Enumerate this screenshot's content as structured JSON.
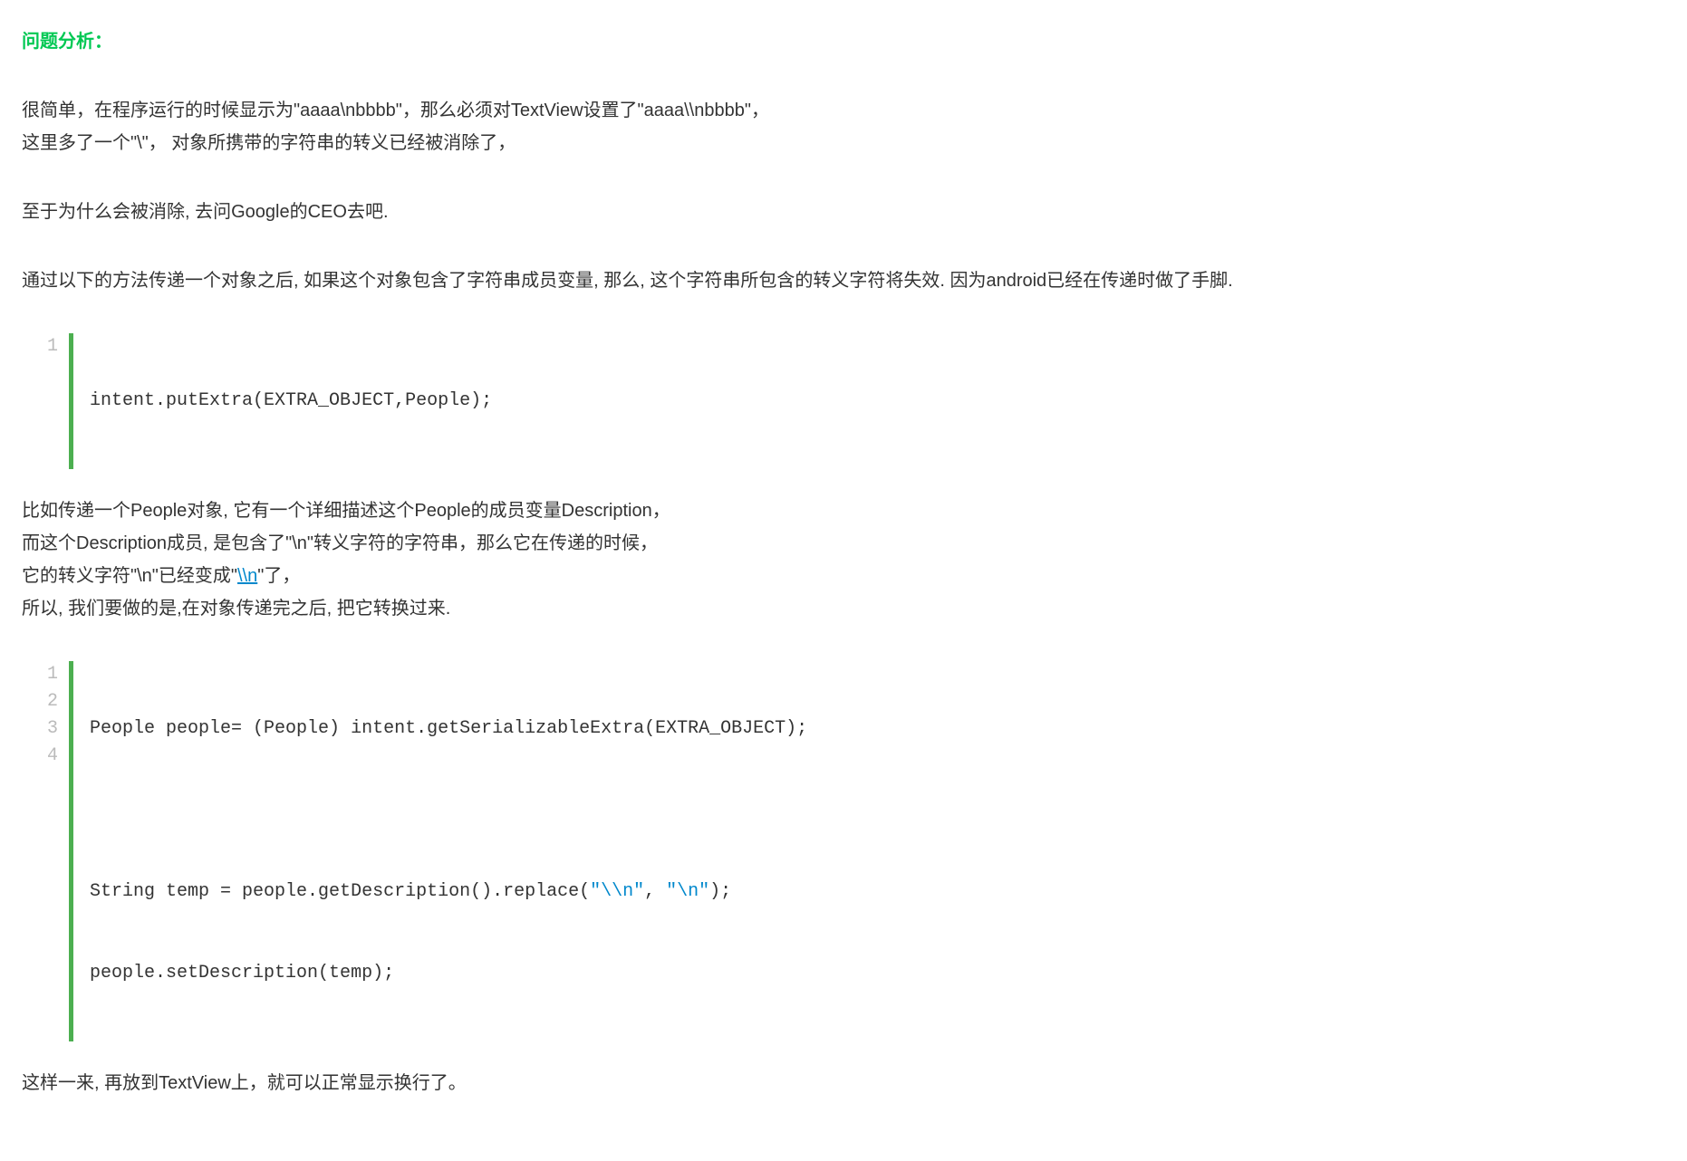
{
  "heading": "问题分析：",
  "para1": {
    "line1": "很简单，在程序运行的时候显示为\"aaaa\\nbbbb\"，那么必须对TextView设置了\"aaaa\\\\nbbbb\"，",
    "line2": "这里多了一个\"\\\"， 对象所携带的字符串的转义已经被消除了，"
  },
  "para2": "至于为什么会被消除, 去问Google的CEO去吧.",
  "para3": "通过以下的方法传递一个对象之后, 如果这个对象包含了字符串成员变量, 那么, 这个字符串所包含的转义字符将失效. 因为android已经在传递时做了手脚.",
  "code1": {
    "ln1": "1",
    "line1": "intent.putExtra(EXTRA_OBJECT,People);"
  },
  "para4": {
    "line1": "比如传递一个People对象, 它有一个详细描述这个People的成员变量Description，",
    "line2": "而这个Description成员, 是包含了\"\\n\"转义字符的字符串，那么它在传递的时候，",
    "line3_a": "它的转义字符\"\\n\"已经变成\"",
    "line3_link": "\\\\n",
    "line3_b": "\"了，",
    "line4": "所以, 我们要做的是,在对象传递完之后, 把它转换过来."
  },
  "code2": {
    "ln1": "1",
    "ln2": "2",
    "ln3": "3",
    "ln4": "4",
    "line1": "People people= (People) intent.getSerializableExtra(EXTRA_OBJECT);",
    "line2": "",
    "line3_a": "String temp = people.getDescription().replace(",
    "line3_s1": "\"\\\\n\"",
    "line3_b": ", ",
    "line3_s2": "\"\\n\"",
    "line3_c": ");",
    "line4": "people.setDescription(temp);"
  },
  "para5": "这样一来, 再放到TextView上，就可以正常显示换行了。"
}
